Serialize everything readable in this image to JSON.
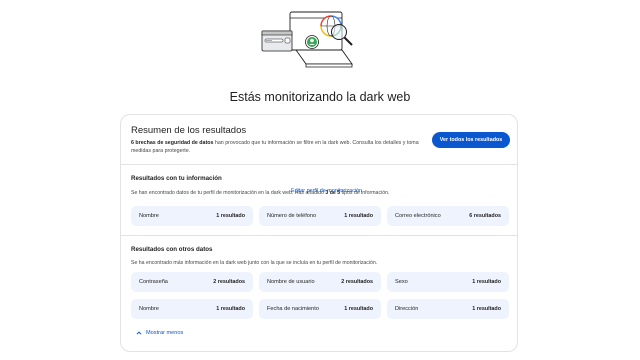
{
  "page": {
    "title": "Estás monitorizando la dark web"
  },
  "summary": {
    "title": "Resumen de los resultados",
    "desc_bold": "6 brechas de seguridad de datos",
    "desc_rest": " han provocado que tu información se filtre en la dark web. Consulta los detalles y toma medidas para protegerte.",
    "button": "Ver todos los resultados"
  },
  "your_info": {
    "title": "Resultados con tu información",
    "desc_pre": "Se han encontrado datos de tu perfil de monitorización en la dark web. Has añadido ",
    "desc_bold": "3 de 5",
    "desc_post": " tipos de información.",
    "edit_link": "Editar perfil de monitorización",
    "tiles": [
      {
        "label": "Nombre",
        "value": "1 resultado"
      },
      {
        "label": "Número de teléfono",
        "value": "1 resultado"
      },
      {
        "label": "Correo electrónico",
        "value": "6 resultados"
      }
    ]
  },
  "other_data": {
    "title": "Resultados con otros datos",
    "desc": "Se ha encontrado más información en la dark web junto con la que se incluía en tu perfil de monitorización.",
    "tiles": [
      {
        "label": "Contraseña",
        "value": "2 resultados"
      },
      {
        "label": "Nombre de usuario",
        "value": "2 resultados"
      },
      {
        "label": "Sexo",
        "value": "1 resultado"
      },
      {
        "label": "Nombre",
        "value": "1 resultado"
      },
      {
        "label": "Fecha de nacimiento",
        "value": "1 resultado"
      },
      {
        "label": "Dirección",
        "value": "1 resultado"
      }
    ]
  },
  "show_less": "Mostrar menos",
  "colors": {
    "accent": "#0b57d0",
    "tile_bg": "#eef3fd",
    "border": "#e3e3e3"
  },
  "icons": [
    "dark-web-illustration-icon",
    "chevron-up-icon"
  ]
}
